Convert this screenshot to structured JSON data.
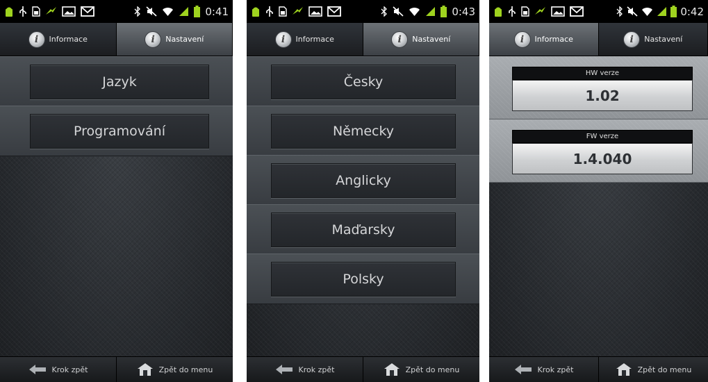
{
  "statusbars": [
    {
      "time": "0:41"
    },
    {
      "time": "0:43"
    },
    {
      "time": "0:42"
    }
  ],
  "tabs": {
    "info": "Informace",
    "settings": "Nastavení"
  },
  "screen1": {
    "buttons": [
      "Jazyk",
      "Programování"
    ]
  },
  "screen2": {
    "buttons": [
      "Česky",
      "Německy",
      "Anglicky",
      "Maďarsky",
      "Polsky"
    ]
  },
  "screen3": {
    "hw_label": "HW verze",
    "hw_value": "1.02",
    "fw_label": "FW verze",
    "fw_value": "1.4.040"
  },
  "bottombar": {
    "back": "Krok zpět",
    "menu": "Zpět do menu"
  },
  "colors": {
    "active_tab": "#6d7277",
    "background": "#2a2d31",
    "status_icon": "#9fd31f"
  }
}
